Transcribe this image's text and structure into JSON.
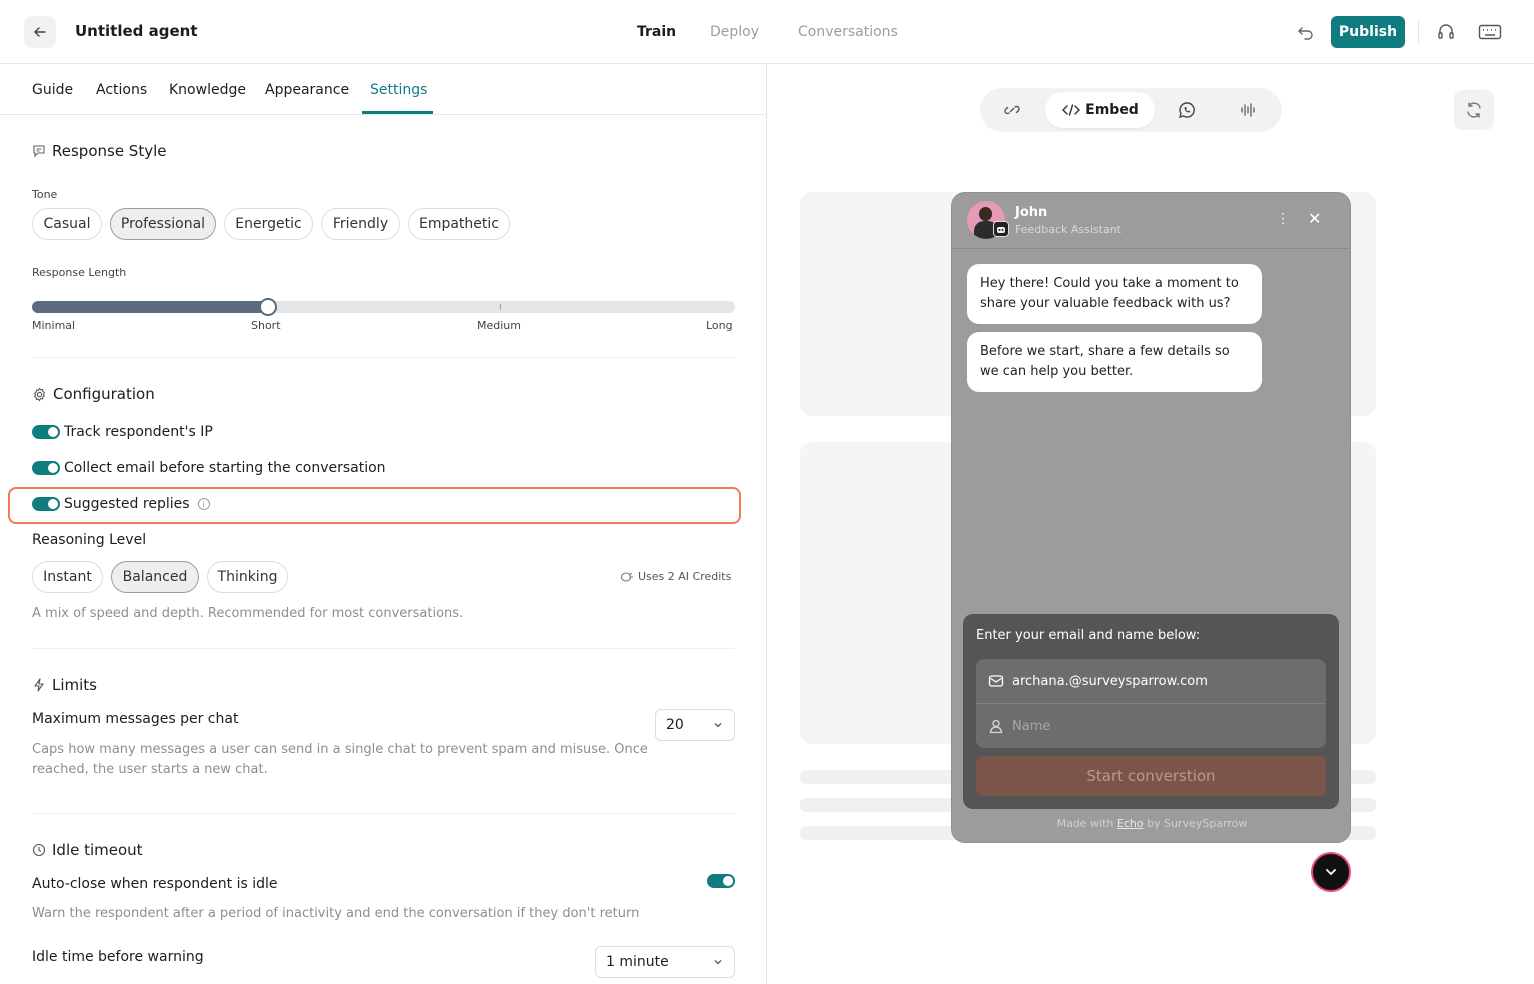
{
  "header": {
    "title": "Untitled agent",
    "tabs": [
      "Train",
      "Deploy",
      "Conversations"
    ],
    "publish_label": "Publish"
  },
  "subtabs": [
    "Guide",
    "Actions",
    "Knowledge",
    "Appearance",
    "Settings"
  ],
  "response_style": {
    "title": "Response Style",
    "tone_label": "Tone",
    "tones": [
      "Casual",
      "Professional",
      "Energetic",
      "Friendly",
      "Empathetic"
    ],
    "selected_tone": "Professional",
    "length_label": "Response Length",
    "length_stops": [
      "Minimal",
      "Short",
      "Medium",
      "Long"
    ],
    "length_value": "Short"
  },
  "configuration": {
    "title": "Configuration",
    "toggles": [
      {
        "label": "Track respondent's IP",
        "on": true
      },
      {
        "label": "Collect email before starting the conversation",
        "on": true
      },
      {
        "label": "Suggested replies",
        "on": true
      }
    ],
    "reasoning_label": "Reasoning Level",
    "reasoning_options": [
      "Instant",
      "Balanced",
      "Thinking"
    ],
    "selected_reasoning": "Balanced",
    "credits_text": "Uses 2 AI Credits",
    "reasoning_desc": "A mix of speed and depth. Recommended for most conversations."
  },
  "limits": {
    "title": "Limits",
    "max_label": "Maximum messages per chat",
    "max_desc": "Caps how many messages a user can send in a single chat to prevent spam and misuse. Once reached, the user starts a new chat.",
    "max_value": "20"
  },
  "idle": {
    "title": "Idle timeout",
    "autoclose_label": "Auto-close when respondent is idle",
    "autoclose_on": true,
    "autoclose_desc": "Warn the respondent after a period of inactivity and end the conversation if they don't return",
    "warning_label": "Idle time before warning",
    "warning_value": "1 minute"
  },
  "preview": {
    "embed_label": "Embed",
    "agent_name": "John",
    "agent_role": "Feedback Assistant",
    "messages": [
      "Hey there! Could you take a moment to share your valuable feedback with us?",
      "Before we start, share a few details so we can help you better."
    ],
    "form_title": "Enter your email and name below:",
    "email_value": "archana.@surveysparrow.com",
    "name_placeholder": "Name",
    "start_label": "Start converstion",
    "footer_prefix": "Made with",
    "footer_link": "Echo",
    "footer_suffix": "by SurveySparrow"
  },
  "colors": {
    "accent": "#0f7d80",
    "highlight": "#ec7d58",
    "start_button": "#7d5449"
  }
}
